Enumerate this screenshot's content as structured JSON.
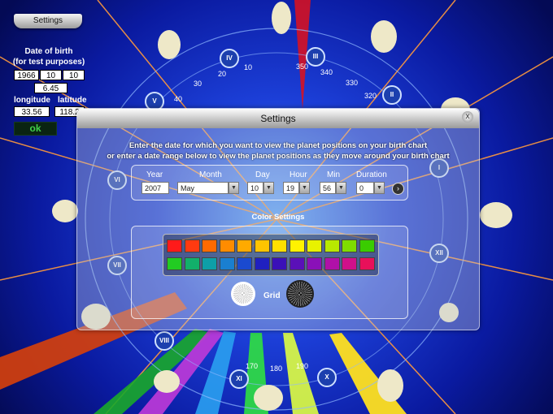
{
  "settings_tab": {
    "label": "Settings"
  },
  "birth_panel": {
    "title_line1": "Date of birth",
    "title_line2": "(for test purposes)",
    "year": "1966",
    "month": "10",
    "day": "10",
    "time": "6.45",
    "longitude_label": "longitude",
    "latitude_label": "latitude",
    "longitude": "33.56",
    "latitude": "118.2",
    "ok_label": "ok"
  },
  "wheel": {
    "degree_ticks": [
      "350",
      "340",
      "330",
      "320",
      "10",
      "20",
      "30",
      "40",
      "170",
      "180",
      "190"
    ],
    "house_numerals": [
      "III",
      "II",
      "IV",
      "V",
      "VI",
      "VII",
      "VIII",
      "XI",
      "X",
      "XII",
      "I"
    ]
  },
  "dialog": {
    "title": "Settings",
    "close_label": "x",
    "instruction_line1": "Enter the date for which you want to view the planet positions on your birth  chart",
    "instruction_line2": "or enter a date range below to view the planet positions as they move around  your birth  chart",
    "fields": {
      "year": {
        "label": "Year",
        "value": "2007"
      },
      "month": {
        "label": "Month",
        "value": "May"
      },
      "day": {
        "label": "Day",
        "value": "10"
      },
      "hour": {
        "label": "Hour",
        "value": "19"
      },
      "min": {
        "label": "Min",
        "value": "56"
      },
      "duration": {
        "label": "Duration",
        "value": "0"
      }
    },
    "color_settings_label": "Color Settings",
    "grid_label": "Grid",
    "palette_row1": [
      "#ff1a1a",
      "#ff3a10",
      "#ff6a00",
      "#ff8c00",
      "#ffaa00",
      "#ffc400",
      "#ffe000",
      "#fff200",
      "#e8f200",
      "#b8e800",
      "#7fdc00",
      "#3acc00"
    ],
    "palette_row2": [
      "#22cc22",
      "#12b06a",
      "#0e9fa8",
      "#1a7fd0",
      "#1a4ad0",
      "#2020c0",
      "#3a10b8",
      "#5a10b8",
      "#8a10b8",
      "#b010a8",
      "#d0108a",
      "#e8105a"
    ]
  },
  "colors": {
    "background": "#07126a",
    "ok_text": "#41d04a"
  }
}
